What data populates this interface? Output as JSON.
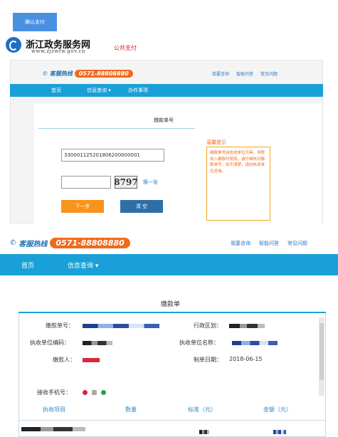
{
  "confirm_button": "确认支付",
  "logo": {
    "title": "浙江政务服务网",
    "url": "www.zjzwfw.gov.cn"
  },
  "public_pay": "公共支付",
  "hotline": {
    "label": "客服热线",
    "number": "0571-88808880"
  },
  "top_links": [
    "我要咨询",
    "智能问答",
    "常见问题"
  ],
  "nav": {
    "home": "首页",
    "info_query": "信息查询 ▾",
    "service": "办件事项"
  },
  "payment_form": {
    "title": "缴款单号",
    "number_value": "330001125201806200000001",
    "captcha": "8797",
    "refresh": "换一张",
    "next": "下一步",
    "clear": "清 空"
  },
  "tips": {
    "title": "温馨提示",
    "text": "缴款单号由执收单位开具，非税收入缴款时使用。请仔细核对缴款单号，如不清楚，请向执收单位咨询。"
  },
  "bill": {
    "title": "缴款单",
    "fields": {
      "bill_no": "缴款单号：",
      "region": "行政区划：",
      "unit_code": "执收单位编码：",
      "unit_name": "执收单位名称：",
      "payer": "缴款人：",
      "date_label": "制单日期：",
      "date_value": "2018-06-15",
      "phone": "接收手机号："
    },
    "columns": [
      "执收项目",
      "数量",
      "标准（元）",
      "金额（元）"
    ]
  }
}
